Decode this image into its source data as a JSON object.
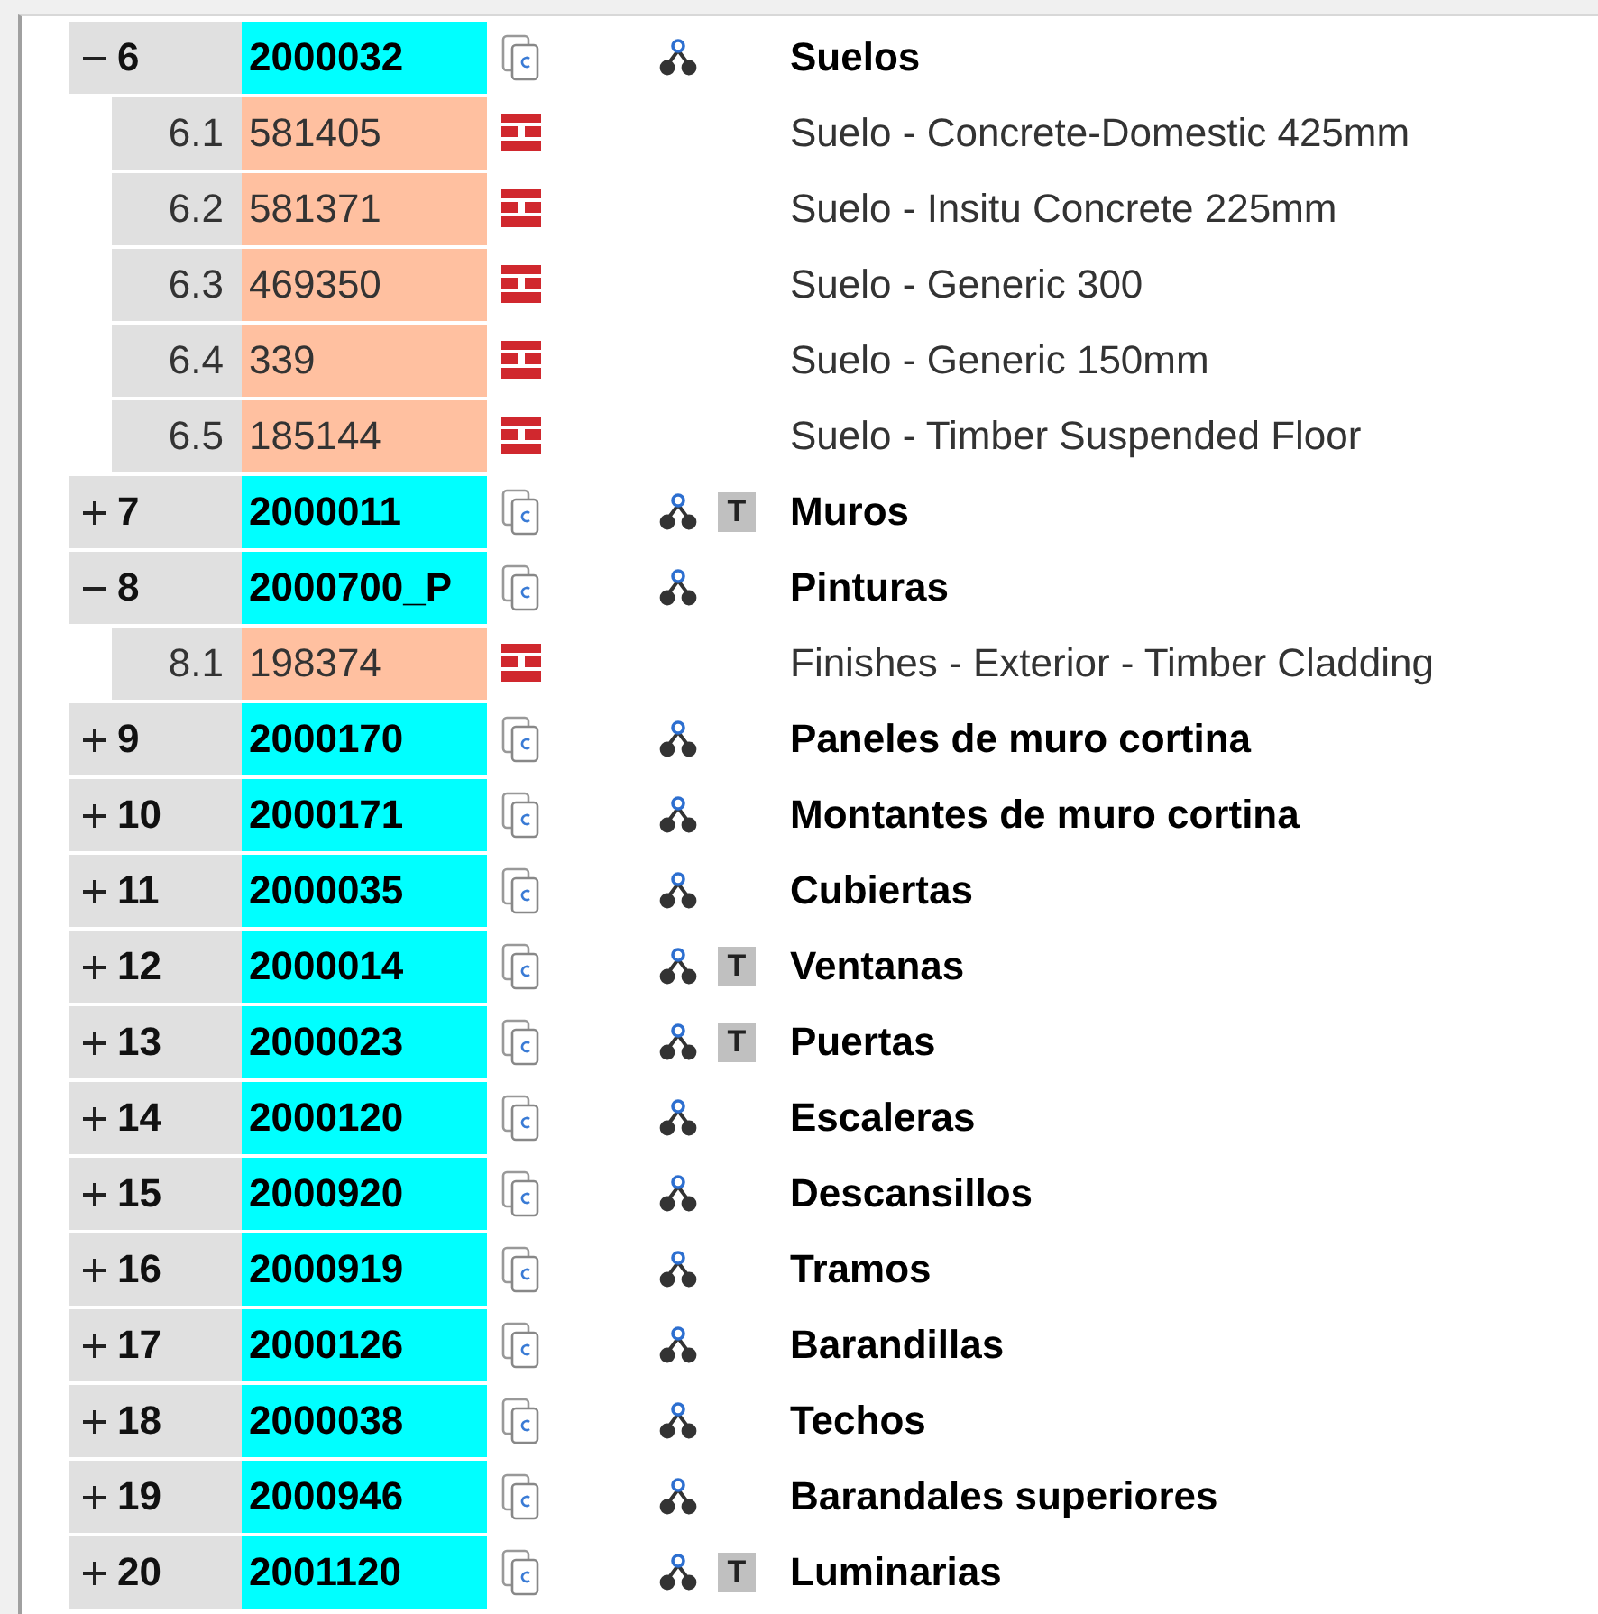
{
  "groups": [
    {
      "number": "6",
      "expanded": true,
      "code": "2000032",
      "name": "Suelos",
      "children": [
        {
          "number": "6.1",
          "code": "581405",
          "name": "Suelo - Concrete-Domestic 425mm"
        },
        {
          "number": "6.2",
          "code": "581371",
          "name": "Suelo - Insitu Concrete 225mm"
        },
        {
          "number": "6.3",
          "code": "469350",
          "name": "Suelo - Generic 300"
        },
        {
          "number": "6.4",
          "code": "339",
          "name": "Suelo - Generic 150mm"
        },
        {
          "number": "6.5",
          "code": "185144",
          "name": "Suelo - Timber Suspended Floor"
        }
      ]
    },
    {
      "number": "7",
      "expanded": false,
      "code": "2000011",
      "name": "Muros",
      "tag": "T"
    },
    {
      "number": "8",
      "expanded": true,
      "code": "2000700_P",
      "name": "Pinturas",
      "children": [
        {
          "number": "8.1",
          "code": "198374",
          "name": "Finishes - Exterior - Timber Cladding"
        }
      ]
    },
    {
      "number": "9",
      "expanded": false,
      "code": "2000170",
      "name": "Paneles de muro cortina"
    },
    {
      "number": "10",
      "expanded": false,
      "code": "2000171",
      "name": "Montantes de muro cortina"
    },
    {
      "number": "11",
      "expanded": false,
      "code": "2000035",
      "name": "Cubiertas"
    },
    {
      "number": "12",
      "expanded": false,
      "code": "2000014",
      "name": "Ventanas",
      "tag": "T"
    },
    {
      "number": "13",
      "expanded": false,
      "code": "2000023",
      "name": "Puertas",
      "tag": "T"
    },
    {
      "number": "14",
      "expanded": false,
      "code": "2000120",
      "name": "Escaleras"
    },
    {
      "number": "15",
      "expanded": false,
      "code": "2000920",
      "name": "Descansillos"
    },
    {
      "number": "16",
      "expanded": false,
      "code": "2000919",
      "name": "Tramos"
    },
    {
      "number": "17",
      "expanded": false,
      "code": "2000126",
      "name": "Barandillas"
    },
    {
      "number": "18",
      "expanded": false,
      "code": "2000038",
      "name": "Techos"
    },
    {
      "number": "19",
      "expanded": false,
      "code": "2000946",
      "name": "Barandales superiores"
    },
    {
      "number": "20",
      "expanded": false,
      "code": "2001120",
      "name": "Luminarias",
      "tag": "T"
    }
  ]
}
